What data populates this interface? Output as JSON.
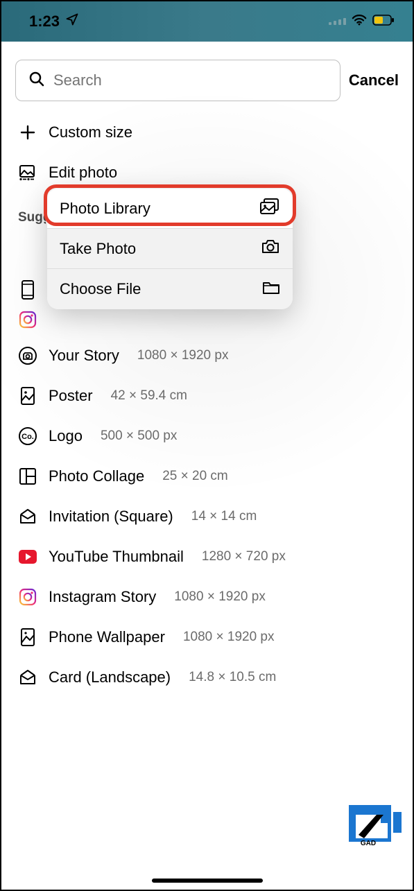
{
  "status": {
    "time": "1:23"
  },
  "search": {
    "placeholder": "Search",
    "cancel": "Cancel"
  },
  "actions": {
    "custom_size": "Custom size",
    "edit_photo": "Edit photo"
  },
  "section": "Suggested",
  "popover": {
    "photo_library": "Photo Library",
    "take_photo": "Take Photo",
    "choose_file": "Choose File"
  },
  "items": [
    {
      "label": "Your Story",
      "dim": "1080 × 1920 px"
    },
    {
      "label": "Poster",
      "dim": "42 × 59.4 cm"
    },
    {
      "label": "Logo",
      "dim": "500 × 500 px"
    },
    {
      "label": "Photo Collage",
      "dim": "25 × 20 cm"
    },
    {
      "label": "Invitation (Square)",
      "dim": "14 × 14 cm"
    },
    {
      "label": "YouTube Thumbnail",
      "dim": "1280 × 720 px"
    },
    {
      "label": "Instagram Story",
      "dim": "1080 × 1920 px"
    },
    {
      "label": "Phone Wallpaper",
      "dim": "1080 × 1920 px"
    },
    {
      "label": "Card (Landscape)",
      "dim": "14.8 × 10.5 cm"
    }
  ]
}
